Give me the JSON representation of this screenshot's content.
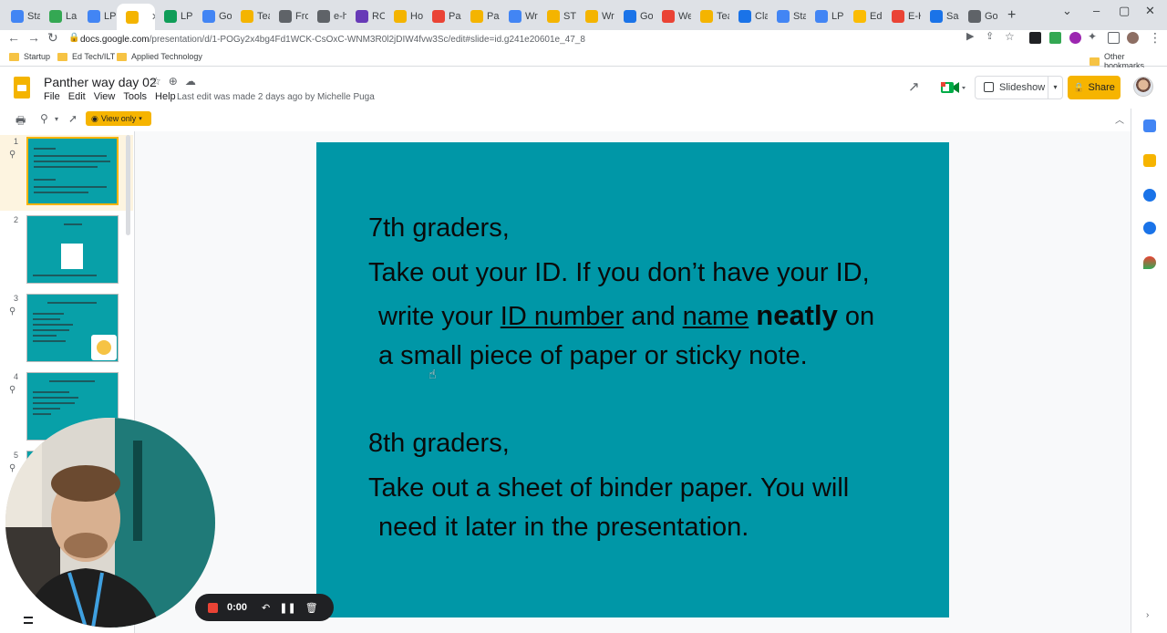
{
  "browser": {
    "tabs": [
      {
        "label": "Staf",
        "color": "#4285f4"
      },
      {
        "label": "La P",
        "color": "#34a853"
      },
      {
        "label": "LPM",
        "color": "#4285f4"
      },
      {
        "label": "",
        "color": "#f4b400",
        "active": true
      },
      {
        "label": "LPM",
        "color": "#0f9d58"
      },
      {
        "label": "Goo",
        "color": "#4285f4"
      },
      {
        "label": "Teac",
        "color": "#f4b400"
      },
      {
        "label": "Fron",
        "color": "#5f6368"
      },
      {
        "label": "e-ha",
        "color": "#5f6368"
      },
      {
        "label": "ROF",
        "color": "#673ab7"
      },
      {
        "label": "How",
        "color": "#f4b400"
      },
      {
        "label": "Paxt",
        "color": "#ea4335"
      },
      {
        "label": "Paxt",
        "color": "#f4b400"
      },
      {
        "label": "Writ",
        "color": "#4285f4"
      },
      {
        "label": "STE",
        "color": "#f4b400"
      },
      {
        "label": "Writ",
        "color": "#f4b400"
      },
      {
        "label": "GoC",
        "color": "#1a73e8"
      },
      {
        "label": "Wel",
        "color": "#ea4335"
      },
      {
        "label": "Teac",
        "color": "#f4b400"
      },
      {
        "label": "Clas",
        "color": "#1a73e8"
      },
      {
        "label": "Staf",
        "color": "#4285f4"
      },
      {
        "label": "LPM",
        "color": "#4285f4"
      },
      {
        "label": "Edp",
        "color": "#fbbc04"
      },
      {
        "label": "E-Ha",
        "color": "#ea4335"
      },
      {
        "label": "Salin",
        "color": "#1a73e8"
      },
      {
        "label": "Goo",
        "color": "#5f6368"
      }
    ],
    "url_prefix": "docs.google.com",
    "url_rest": "/presentation/d/1-POGy2x4bg4Fd1WCK-CsOxC-WNM3R0l2jDIW4fvw3Sc/edit#slide=id.g241e20601e_47_8",
    "bookmarks": [
      "Startup",
      "Ed Tech/ILT",
      "Applied Technology"
    ],
    "other_bookmarks": "Other bookmarks"
  },
  "doc": {
    "title": "Panther way day 02",
    "menu": [
      "File",
      "Edit",
      "View",
      "Tools",
      "Help"
    ],
    "last_edit": "Last edit was made 2 days ago by Michelle Puga",
    "slideshow_label": "Slideshow",
    "share_label": "Share",
    "view_only_label": "View only"
  },
  "filmstrip": {
    "numbers": [
      "1",
      "2",
      "3",
      "4",
      "5"
    ]
  },
  "slide": {
    "line1": "7th graders,",
    "line2": "Take out your ID. If you don’t have your ID,",
    "line3_a": "write your ",
    "line3_b": "ID number",
    "line3_c": " and ",
    "line3_d": "name",
    "line3_e": " ",
    "line3_f": "neatly",
    "line3_g": " on",
    "line4": "a small piece of paper or sticky note.",
    "line5": "8th graders,",
    "line6": "Take out a sheet of binder paper. You will",
    "line7": "need it later in the presentation."
  },
  "recorder": {
    "time": "0:00"
  },
  "colors": {
    "slide_bg": "#0097a7",
    "accent": "#f6b400"
  }
}
